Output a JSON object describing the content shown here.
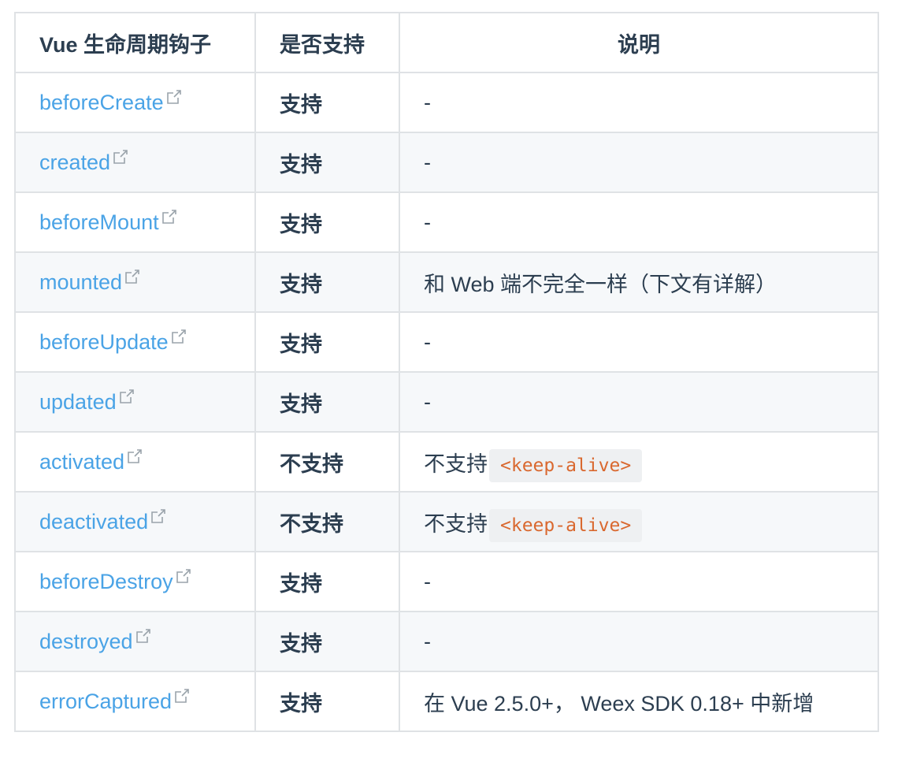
{
  "header": {
    "col_hook": "Vue 生命周期钩子",
    "col_support": "是否支持",
    "col_desc": "说明"
  },
  "rows": [
    {
      "hook": "beforeCreate",
      "support": "支持",
      "desc": "-",
      "code": ""
    },
    {
      "hook": "created",
      "support": "支持",
      "desc": "-",
      "code": ""
    },
    {
      "hook": "beforeMount",
      "support": "支持",
      "desc": "-",
      "code": ""
    },
    {
      "hook": "mounted",
      "support": "支持",
      "desc": "和 Web 端不完全一样（下文有详解）",
      "code": ""
    },
    {
      "hook": "beforeUpdate",
      "support": "支持",
      "desc": "-",
      "code": ""
    },
    {
      "hook": "updated",
      "support": "支持",
      "desc": "-",
      "code": ""
    },
    {
      "hook": "activated",
      "support": "不支持",
      "desc": "不支持",
      "code": "<keep-alive>"
    },
    {
      "hook": "deactivated",
      "support": "不支持",
      "desc": "不支持",
      "code": "<keep-alive>"
    },
    {
      "hook": "beforeDestroy",
      "support": "支持",
      "desc": "-",
      "code": ""
    },
    {
      "hook": "destroyed",
      "support": "支持",
      "desc": "-",
      "code": ""
    },
    {
      "hook": "errorCaptured",
      "support": "支持",
      "desc": "在 Vue 2.5.0+， Weex SDK 0.18+ 中新增",
      "code": ""
    }
  ],
  "icons": {
    "external_link": "external-link-icon"
  },
  "colors": {
    "link": "#4aa3e6",
    "text": "#2c3e50",
    "border": "#dfe2e5",
    "zebra": "#f6f8fa",
    "code_text": "#d9682f",
    "code_bg": "#eef0f2"
  }
}
